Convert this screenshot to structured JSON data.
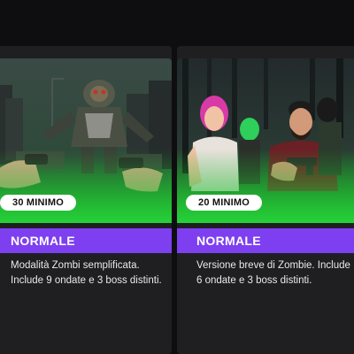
{
  "cards": [
    {
      "duration": "30 MINIMO",
      "mode": "NORMALE",
      "description": "Modalità Zombi semplificata. Include 9 ondate e 3 boss distinti."
    },
    {
      "duration": "20 MINIMO",
      "mode": "NORMALE",
      "description": "Versione breve di Zombie. Include 6 ondate e 3 boss distinti."
    }
  ],
  "colors": {
    "background": "#0e0e10",
    "card": "#1f1f22",
    "mode_bar": "#7e3ff0",
    "thumb_glow": "#2fd23a"
  }
}
